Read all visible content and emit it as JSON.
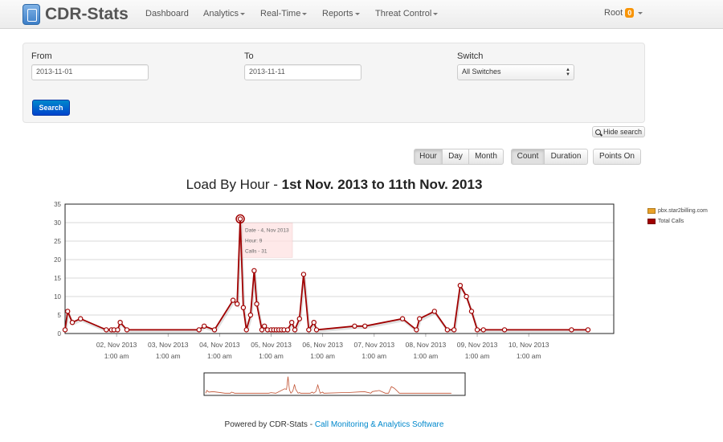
{
  "app": {
    "title": "CDR-Stats"
  },
  "nav": {
    "dashboard": "Dashboard",
    "analytics": "Analytics",
    "realtime": "Real-Time",
    "reports": "Reports",
    "threat": "Threat Control",
    "user": "Root",
    "badge": "0"
  },
  "search": {
    "from_label": "From",
    "from_value": "2013-11-01",
    "to_label": "To",
    "to_value": "2013-11-11",
    "switch_label": "Switch",
    "switch_value": "All Switches",
    "search_button": "Search",
    "hide_button": "Hide search"
  },
  "toolbar": {
    "hour": "Hour",
    "day": "Day",
    "month": "Month",
    "count": "Count",
    "duration": "Duration",
    "points": "Points On"
  },
  "chart": {
    "title_prefix": "Load By Hour - ",
    "title_bold": "1st Nov. 2013 to 11th Nov. 2013",
    "tooltip": [
      "Date - 4, Nov 2013",
      "Hour: 9",
      "Calls - 31"
    ],
    "x_tick_time": "1:00 am",
    "legend": [
      {
        "name": "pbx.star2billing.com",
        "color": "#eaa228"
      },
      {
        "name": "Total Calls",
        "color": "#a00000"
      }
    ]
  },
  "chart_data": {
    "type": "line",
    "title": "Load By Hour - 1st Nov. 2013 to 11th Nov. 2013",
    "xlabel": "",
    "ylabel": "",
    "ylim": [
      0,
      35
    ],
    "yticks": [
      0,
      5,
      10,
      15,
      20,
      25,
      30,
      35
    ],
    "xlim": [
      0,
      10.65
    ],
    "xticks": [
      {
        "x": 1,
        "label": "02, Nov 2013"
      },
      {
        "x": 2,
        "label": "03, Nov 2013"
      },
      {
        "x": 3,
        "label": "04, Nov 2013"
      },
      {
        "x": 4,
        "label": "05, Nov 2013"
      },
      {
        "x": 5,
        "label": "06, Nov 2013"
      },
      {
        "x": 6,
        "label": "07, Nov 2013"
      },
      {
        "x": 7,
        "label": "08, Nov 2013"
      },
      {
        "x": 8,
        "label": "09, Nov 2013"
      },
      {
        "x": 9,
        "label": "10, Nov 2013"
      }
    ],
    "grid": true,
    "legend_position": "right",
    "series": [
      {
        "name": "Total Calls",
        "points": [
          [
            0.0,
            1
          ],
          [
            0.05,
            6
          ],
          [
            0.14,
            3
          ],
          [
            0.3,
            4
          ],
          [
            0.8,
            1
          ],
          [
            0.9,
            1
          ],
          [
            0.95,
            1
          ],
          [
            1.02,
            1
          ],
          [
            1.07,
            3
          ],
          [
            1.2,
            1
          ],
          [
            2.6,
            1
          ],
          [
            2.7,
            2
          ],
          [
            2.9,
            1
          ],
          [
            3.26,
            9
          ],
          [
            3.34,
            8
          ],
          [
            3.4,
            31
          ],
          [
            3.46,
            7
          ],
          [
            3.52,
            1
          ],
          [
            3.6,
            5
          ],
          [
            3.67,
            17
          ],
          [
            3.72,
            8
          ],
          [
            3.82,
            1
          ],
          [
            3.87,
            2
          ],
          [
            3.93,
            1
          ],
          [
            4.0,
            1
          ],
          [
            4.05,
            1
          ],
          [
            4.1,
            1
          ],
          [
            4.15,
            1
          ],
          [
            4.2,
            1
          ],
          [
            4.25,
            1
          ],
          [
            4.32,
            1
          ],
          [
            4.4,
            3
          ],
          [
            4.46,
            1
          ],
          [
            4.55,
            4
          ],
          [
            4.63,
            16
          ],
          [
            4.73,
            1
          ],
          [
            4.83,
            3
          ],
          [
            4.88,
            1
          ],
          [
            5.62,
            2
          ],
          [
            5.82,
            2
          ],
          [
            6.55,
            4
          ],
          [
            6.82,
            1
          ],
          [
            6.88,
            4
          ],
          [
            7.17,
            6
          ],
          [
            7.42,
            1
          ],
          [
            7.55,
            1
          ],
          [
            7.67,
            13
          ],
          [
            7.79,
            10
          ],
          [
            7.89,
            6
          ],
          [
            8.0,
            1
          ],
          [
            8.12,
            1
          ],
          [
            8.53,
            1
          ],
          [
            9.83,
            1
          ],
          [
            10.15,
            1
          ]
        ]
      }
    ],
    "tooltip_point": {
      "date": "4, Nov 2013",
      "hour": 9,
      "calls": 31
    }
  },
  "footer": {
    "prefix": "Powered by CDR-Stats - ",
    "link": "Call Monitoring & Analytics Software"
  }
}
